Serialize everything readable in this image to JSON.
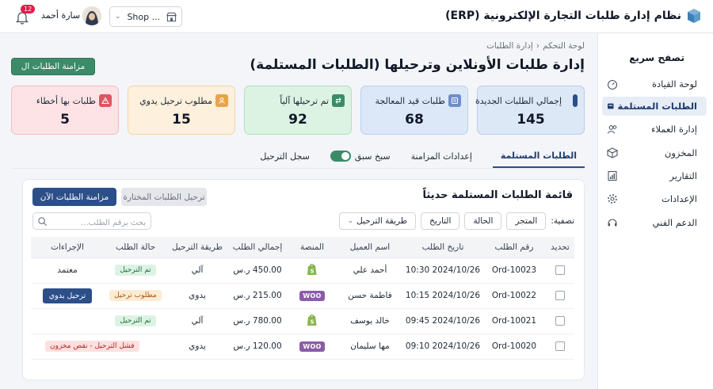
{
  "app": {
    "title": "نظام إدارة طلبات التجارة الإلكترونية (ERP)"
  },
  "header": {
    "user_name": "سارة أحمد",
    "notification_count": "12",
    "shop_selector": "Shop ..."
  },
  "sidebar": {
    "heading": "تصفح سريع",
    "items": [
      {
        "label": "لوحة القيادة",
        "icon": "dashboard-icon"
      },
      {
        "label": "الطلبات المستلمة",
        "icon": "inbox-icon",
        "active": true
      },
      {
        "label": "إدارة العملاء",
        "icon": "users-icon"
      },
      {
        "label": "المخزون",
        "icon": "box-icon"
      },
      {
        "label": "التقارير",
        "icon": "report-icon"
      },
      {
        "label": "الإعدادات",
        "icon": "gear-icon"
      },
      {
        "label": "الدعم الفني",
        "icon": "headset-icon"
      }
    ]
  },
  "breadcrumb": {
    "home": "لوحة التحكم",
    "current": "إدارة الطلبات"
  },
  "page": {
    "title": "إدارة طلبات الأونلاين وترحيلها (الطلبات المستلمة)",
    "sync_button": "مزامنة الطلبات ال"
  },
  "stats": [
    {
      "label": "إجمالي الطلبات الجديدة",
      "value": "145",
      "color": "#dde8f7"
    },
    {
      "label": "طلبات قيد المعالجة",
      "value": "68",
      "color": "#dce8f8"
    },
    {
      "label": "تم ترحيلها آلياً",
      "value": "92",
      "color": "#dcf3e3"
    },
    {
      "label": "مطلوب ترحيل يدوي",
      "value": "15",
      "color": "#fdf0dc"
    },
    {
      "label": "طلبات بها أخطاء",
      "value": "5",
      "color": "#fde3e6"
    }
  ],
  "tabs": {
    "received": "الطلبات المستلمة",
    "sync_settings": "إعدادات المزامنة",
    "pre_pull": "سبخ سبق",
    "posting_log": "سجل الترحيل"
  },
  "panel": {
    "title": "قائمة الطلبات المستلمة حديثاً",
    "sync_now": "مزامنة الطلبات الآن",
    "post_selected": "ترحيل الطلبات المختارة",
    "filter_label": "تصفية:",
    "filters": {
      "store": "المتجر",
      "status": "الحالة",
      "date": "التاريخ",
      "method": "طريقة الترحيل"
    },
    "search_placeholder": "بحث برقم الطلب..."
  },
  "table": {
    "headers": {
      "select": "تحديد",
      "order_no": "رقم الطلب",
      "order_date": "تاريخ الطلب",
      "customer": "اسم العميل",
      "platform": "المنصة",
      "total": "إجمالي الطلب",
      "method": "طريقة الترحيل",
      "status": "حالة الطلب",
      "actions": "الإجراءات"
    },
    "rows": [
      {
        "order_no": "Ord-10023",
        "date": "2024/10/26 10:30",
        "customer": "أحمد علي",
        "platform": "shopify",
        "total": "450.00 ر.س",
        "method": "آلي",
        "status": "تم الترحيل",
        "action": "معتمد"
      },
      {
        "order_no": "Ord-10022",
        "date": "2024/10/26 10:15",
        "customer": "فاطمة حسن",
        "platform": "woocommerce",
        "platform_text": "WOO",
        "total": "215.00 ر.س",
        "method": "يدوي",
        "status": "مطلوب ترحيل",
        "action": "ترحيل يدوي"
      },
      {
        "order_no": "Ord-10021",
        "date": "2024/10/26 09:45",
        "customer": "خالد يوسف",
        "platform": "shopify",
        "total": "780.00 ر.س",
        "method": "آلي",
        "status": "تم الترحيل",
        "action": ""
      },
      {
        "order_no": "Ord-10020",
        "date": "2024/10/26 09:10",
        "customer": "مها سليمان",
        "platform": "woocommerce",
        "platform_text": "WOO",
        "total": "120.00 ر.س",
        "method": "يدوي",
        "status": "فشل الترحيل - نقص مخزون",
        "action": ""
      }
    ]
  },
  "colors": {
    "primary": "#2c4f8a",
    "accent_green": "#3b8b69",
    "error": "#b42323"
  }
}
